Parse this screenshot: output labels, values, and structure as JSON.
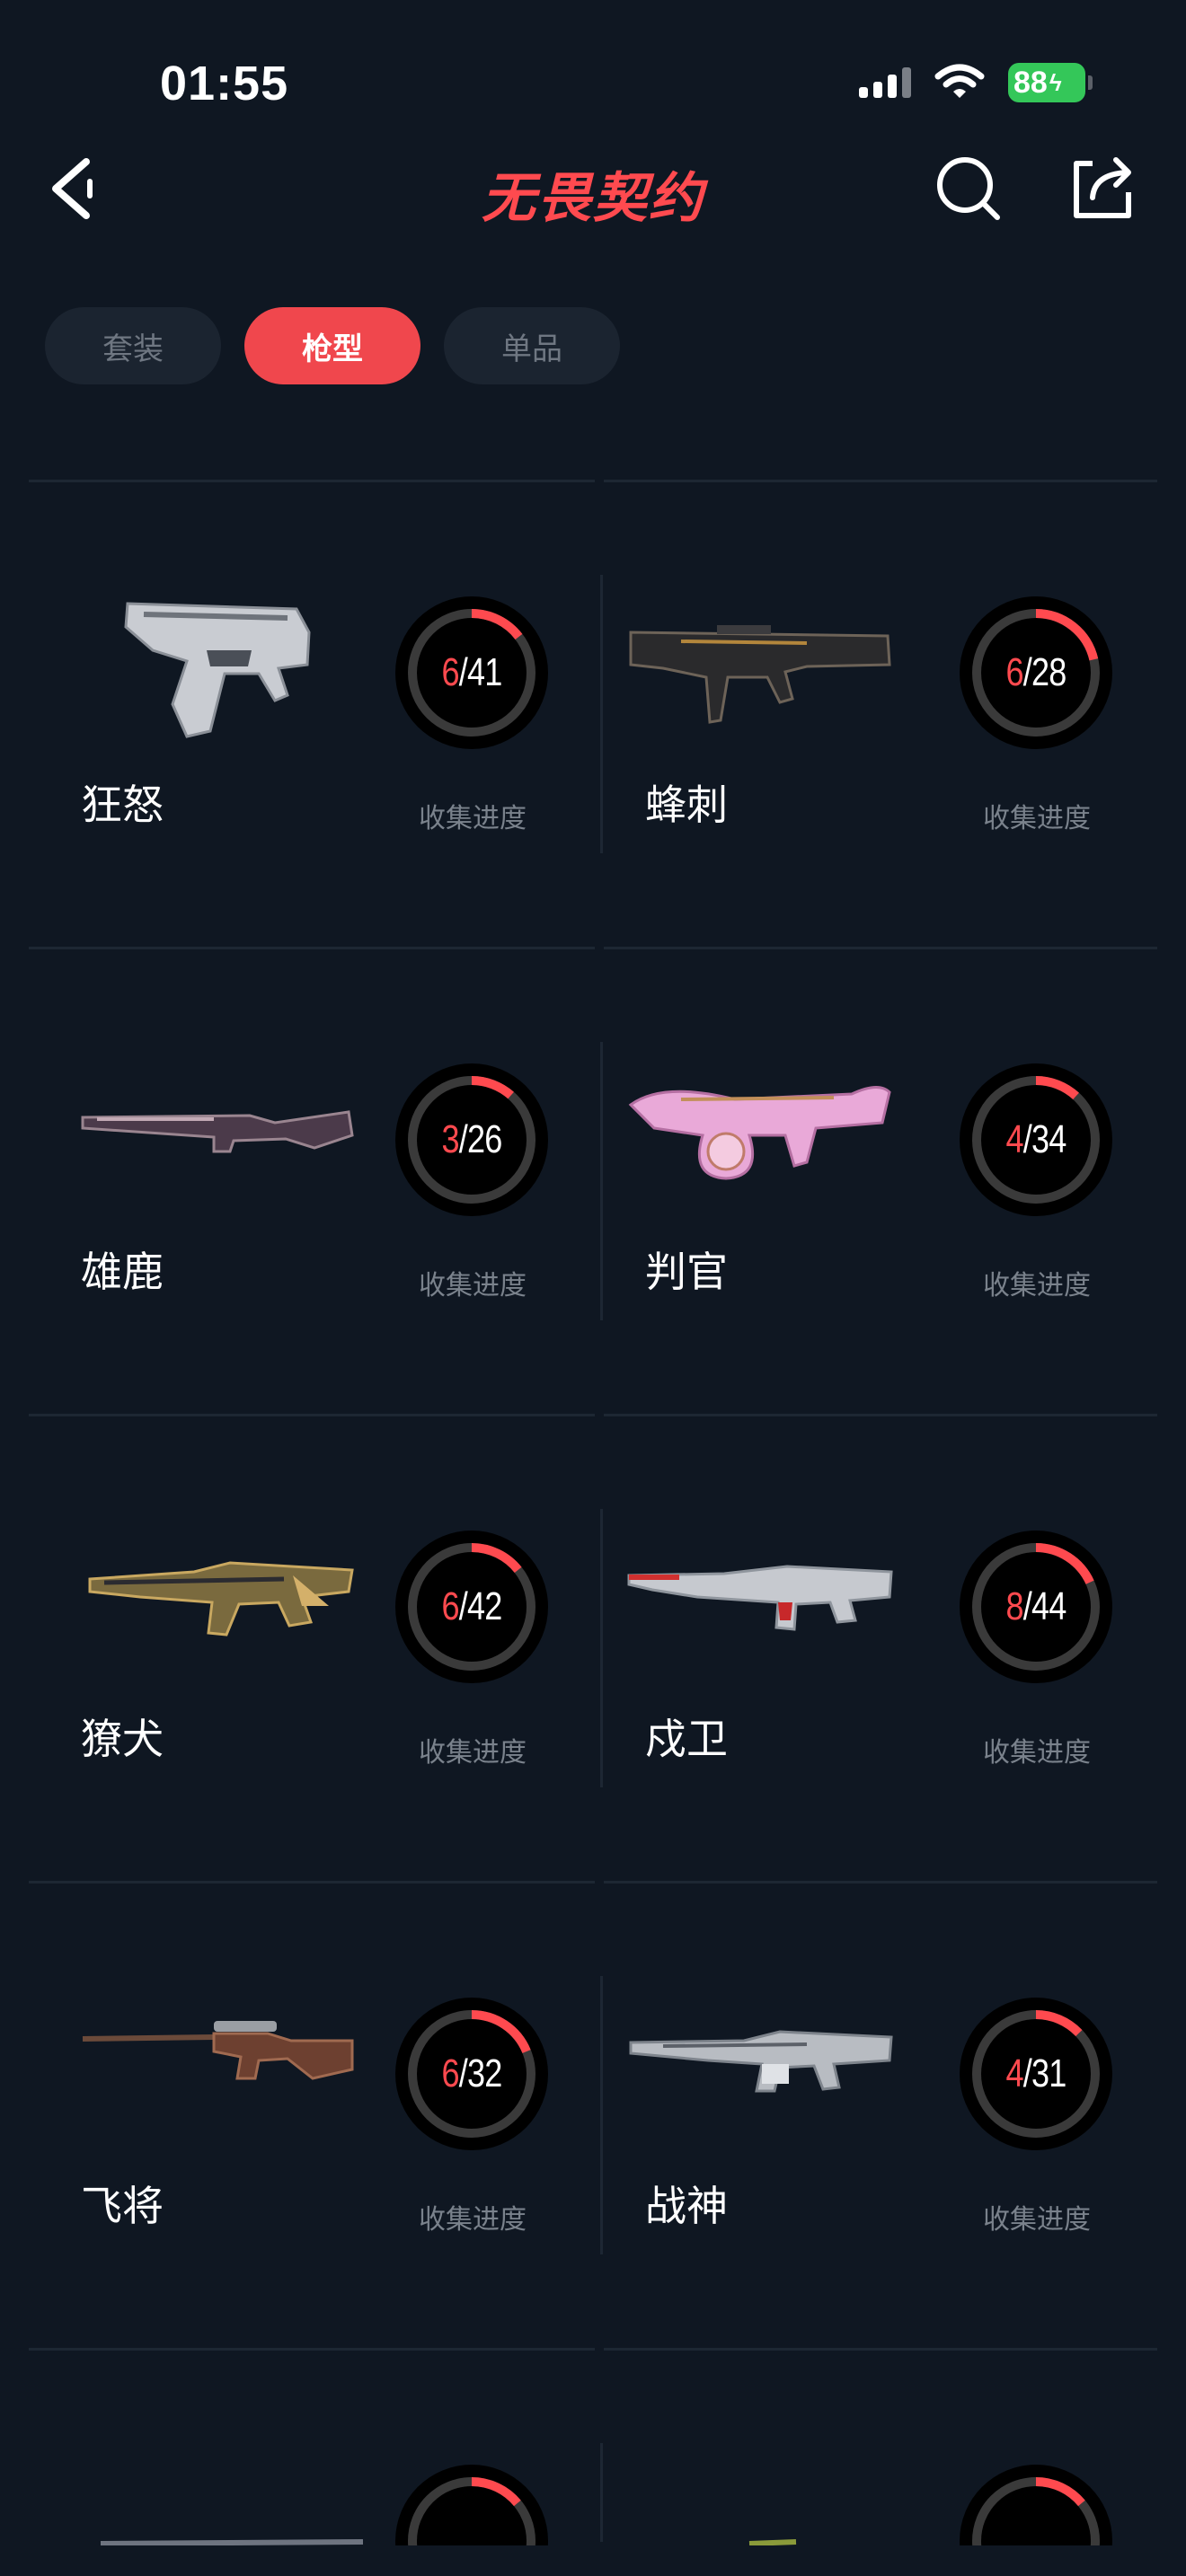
{
  "status_bar": {
    "time": "01:55",
    "battery": "88"
  },
  "header": {
    "title": "无畏契约"
  },
  "tabs": [
    {
      "label": "套装",
      "active": false
    },
    {
      "label": "枪型",
      "active": true
    },
    {
      "label": "单品",
      "active": false
    }
  ],
  "progress_caption": "收集进度",
  "weapons": [
    {
      "name": "狂怒",
      "collected": "6",
      "total": "/41",
      "fraction": 0.146
    },
    {
      "name": "蜂刺",
      "collected": "6",
      "total": "/28",
      "fraction": 0.214
    },
    {
      "name": "雄鹿",
      "collected": "3",
      "total": "/26",
      "fraction": 0.115
    },
    {
      "name": "判官",
      "collected": "4",
      "total": "/34",
      "fraction": 0.118
    },
    {
      "name": "獠犬",
      "collected": "6",
      "total": "/42",
      "fraction": 0.143
    },
    {
      "name": "戍卫",
      "collected": "8",
      "total": "/44",
      "fraction": 0.182
    },
    {
      "name": "飞将",
      "collected": "6",
      "total": "/32",
      "fraction": 0.188
    },
    {
      "name": "战神",
      "collected": "4",
      "total": "/31",
      "fraction": 0.129
    }
  ],
  "colors": {
    "accent": "#f0474d",
    "background": "#0f1722",
    "ring_track": "#3a3a3a",
    "ring_fill": "#ff4a4f"
  }
}
